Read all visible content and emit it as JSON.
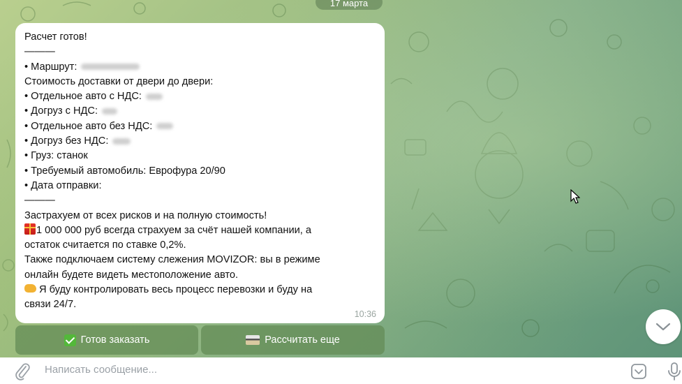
{
  "date_pill": "17 марта",
  "message": {
    "lines": [
      "Расчет готов!",
      "———",
      "• Маршрут:",
      "Стоимость доставки от двери до двери:",
      "• Отдельное авто с НДС:",
      "• Догруз с НДС:",
      "• Отдельное авто без НДС:",
      "• Догруз без НДС:",
      "• Груз: станок",
      "• Требуемый автомобиль: Еврофура 20/90",
      "• Дата отправки:",
      "———",
      "Застрахуем от всех рисков и на полную стоимость!",
      "1 000 000 руб всегда страхуем за счёт нашей компании, а",
      "остаток считается по ставке 0,2%.",
      "Также подключаем систему слежения MOVIZOR: вы в режиме",
      "онлайн будете видеть местоположение авто.",
      "Я буду контролировать весь процесс перевозки и буду на",
      "связи 24/7."
    ],
    "time": "10:36"
  },
  "keyboard": {
    "order_label": "Готов заказать",
    "recalc_label": "Рассчитать еще"
  },
  "input": {
    "placeholder": "Написать сообщение..."
  },
  "icons": {
    "attach": "paperclip-icon",
    "emoji": "emoji-icon",
    "mic": "microphone-icon",
    "scroll": "chevron-down-icon"
  },
  "colors": {
    "bubble": "#ffffff",
    "keyboard_button": "#628a54",
    "check_green": "#53b83a"
  }
}
